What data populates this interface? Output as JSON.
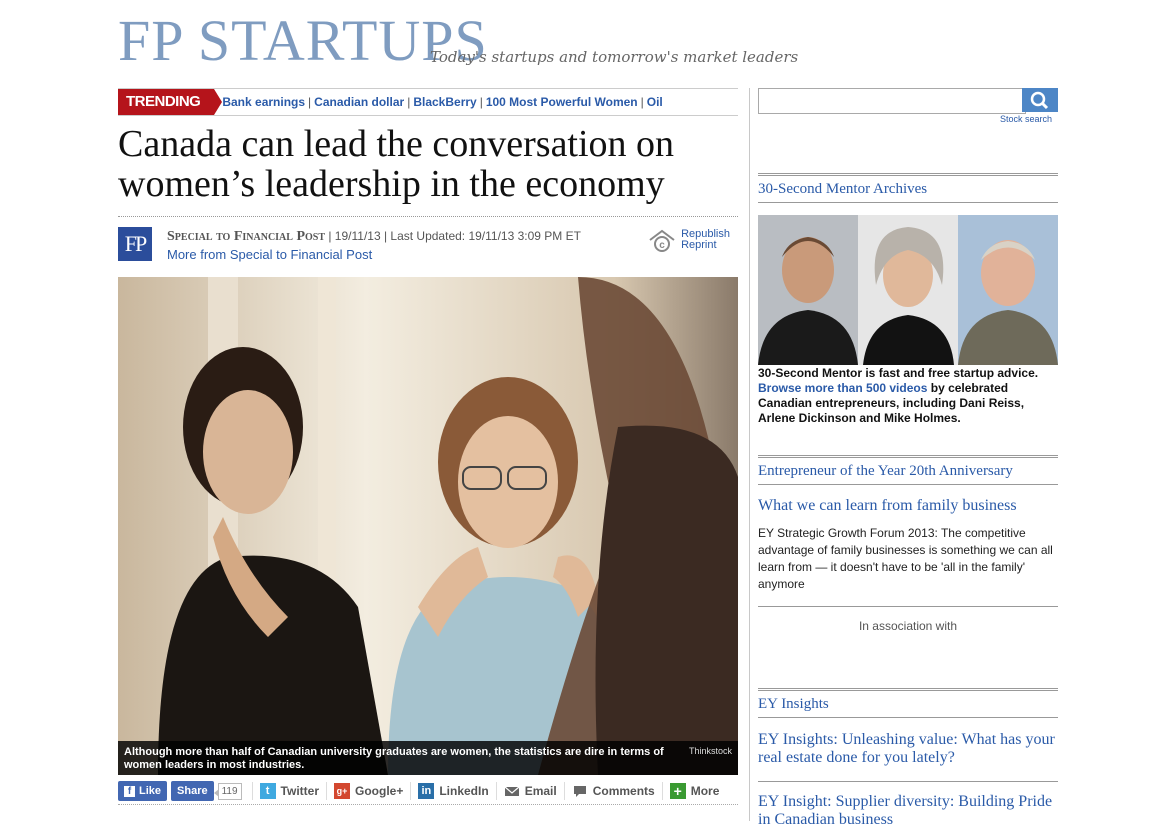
{
  "masthead": {
    "brand": "FP STARTUPS",
    "tagline": "Today's startups and tomorrow's market leaders"
  },
  "trending": {
    "tag": "TRENDING",
    "links": [
      "Bank earnings",
      "Canadian dollar",
      "BlackBerry",
      "100 Most Powerful Women",
      "Oil"
    ],
    "separator": "|"
  },
  "article": {
    "headline": "Canada can lead the conversation on women’s leadership in the economy",
    "logo": "FP",
    "author": "Special to Financial Post",
    "dates": " | 19/11/13 | Last Updated: 19/11/13 3:09 PM ET",
    "more_link": "More from Special to Financial Post",
    "republish": "Republish",
    "reprint": "Reprint",
    "caption": "Although more than half of Canadian university graduates are women, the statistics are dire in terms of women leaders in most industries.",
    "credit": "Thinkstock"
  },
  "share": {
    "like": "Like",
    "share": "Share",
    "count": "119",
    "twitter": "Twitter",
    "googleplus": "Google+",
    "linkedin": "LinkedIn",
    "email": "Email",
    "comments": "Comments",
    "more": "More"
  },
  "sidebar": {
    "search": {
      "placeholder": "",
      "stock_search": "Stock search"
    },
    "mentor": {
      "heading": "30-Second Mentor Archives",
      "text_lead": "30-Second Mentor is fast and free startup advice. ",
      "link": "Browse more than 500 videos",
      "text_tail": " by celebrated Canadian entrepreneurs, including Dani Reiss, Arlene Dickinson and Mike Holmes."
    },
    "eoy": {
      "heading": "Entrepreneur of the Year 20th Anniversary",
      "title": "What we can learn from family business",
      "body": "EY Strategic Growth Forum 2013: The competitive advantage of family businesses is something we can all learn from — it doesn't have to be 'all in the family' anymore",
      "association": "In association with"
    },
    "ey": {
      "heading": "EY Insights",
      "item1": "EY Insights: Unleashing value: What has your real estate done for you lately?",
      "item2": "EY Insight: Supplier diversity: Building Pride in Canadian business"
    }
  },
  "colors": {
    "brand": "#7f9cc0",
    "trending": "#b5141b",
    "link": "#2a5aa8",
    "facebook": "#4267b2"
  }
}
